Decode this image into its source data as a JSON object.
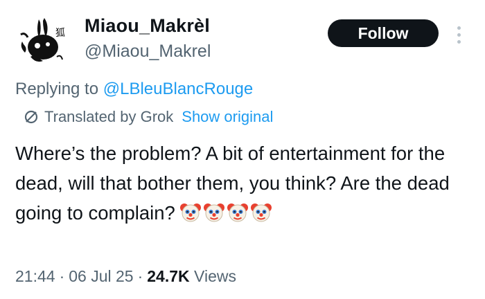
{
  "author": {
    "display_name": "Miaou_Makrèl",
    "handle": "@Miaou_Makrel",
    "avatar_icon": "black-rabbit-sketch-icon"
  },
  "header": {
    "follow_label": "Follow",
    "more_icon": "more-vertical-icon"
  },
  "reply": {
    "prefix": "Replying to",
    "mention": "@LBleuBlancRouge"
  },
  "translation": {
    "label": "Translated by Grok",
    "show_original": "Show original",
    "icon": "translate-icon"
  },
  "tweet": {
    "text": "Where’s the problem? A bit of entertainment for the dead, will that bother them, you think? Are the dead going to complain?",
    "emoji": [
      "clown-face-emoji",
      "clown-face-emoji",
      "clown-face-emoji",
      "clown-face-emoji"
    ]
  },
  "meta": {
    "time": "21:44",
    "date": "06 Jul 25",
    "views_count": "24.7K",
    "views_label": "Views",
    "separator": "·"
  },
  "colors": {
    "accent": "#1d9bf0",
    "secondary_text": "#536471",
    "button_bg": "#0f1419"
  }
}
